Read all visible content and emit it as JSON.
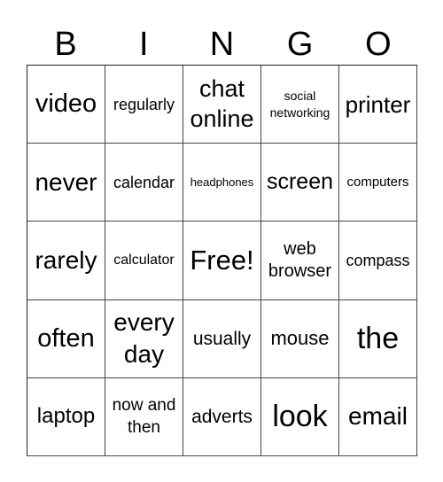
{
  "header": {
    "letters": [
      "B",
      "I",
      "N",
      "G",
      "O"
    ]
  },
  "cells": [
    [
      {
        "text": "video",
        "size": 29,
        "lh": 1.0
      },
      {
        "text": "regularly",
        "size": 18,
        "lh": 1.0
      },
      {
        "text": "chat online",
        "size": 27,
        "lh": 1.25
      },
      {
        "text": "social networking",
        "size": 14,
        "lh": 1.35
      },
      {
        "text": "printer",
        "size": 26,
        "lh": 1.0
      }
    ],
    [
      {
        "text": "never",
        "size": 28,
        "lh": 1.0
      },
      {
        "text": "calendar",
        "size": 18,
        "lh": 1.0
      },
      {
        "text": "headphones",
        "size": 13,
        "lh": 1.0
      },
      {
        "text": "screen",
        "size": 25,
        "lh": 1.0
      },
      {
        "text": "computers",
        "size": 15,
        "lh": 1.0
      }
    ],
    [
      {
        "text": "rarely",
        "size": 28,
        "lh": 1.0
      },
      {
        "text": "calculator",
        "size": 16,
        "lh": 1.0
      },
      {
        "text": "Free!",
        "size": 31,
        "lh": 1.0
      },
      {
        "text": "web browser",
        "size": 20,
        "lh": 1.25
      },
      {
        "text": "compass",
        "size": 18,
        "lh": 1.0
      }
    ],
    [
      {
        "text": "often",
        "size": 29,
        "lh": 1.0
      },
      {
        "text": "every day",
        "size": 28,
        "lh": 1.3
      },
      {
        "text": "usually",
        "size": 21,
        "lh": 1.0
      },
      {
        "text": "mouse",
        "size": 22,
        "lh": 1.0
      },
      {
        "text": "the",
        "size": 34,
        "lh": 1.0
      }
    ],
    [
      {
        "text": "laptop",
        "size": 24,
        "lh": 1.0
      },
      {
        "text": "now and then",
        "size": 19,
        "lh": 1.35
      },
      {
        "text": "adverts",
        "size": 21,
        "lh": 1.0
      },
      {
        "text": "look",
        "size": 34,
        "lh": 1.0
      },
      {
        "text": "email",
        "size": 28,
        "lh": 1.0
      }
    ]
  ]
}
